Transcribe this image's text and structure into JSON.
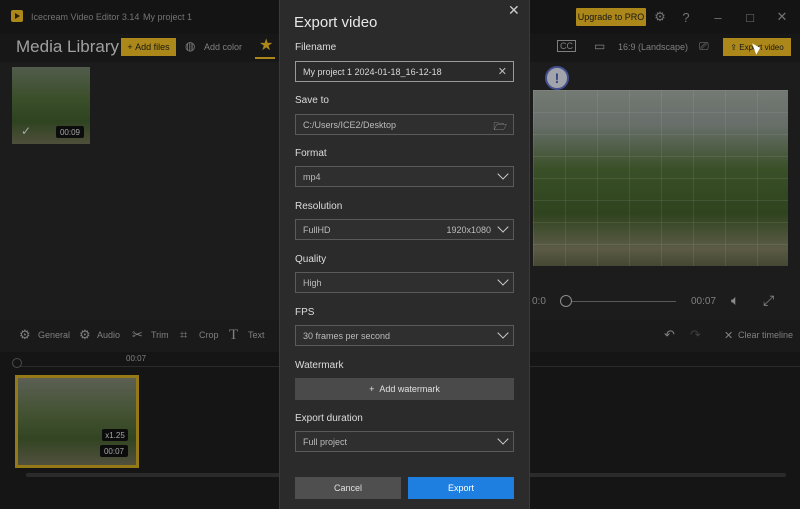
{
  "window": {
    "app_name": "Icecream Video Editor 3.14",
    "project_name": "My project 1",
    "upgrade_label": "Upgrade to PRO"
  },
  "toolbar": {
    "media_library": "Media Library",
    "add_files": "Add files",
    "add_color": "Add color",
    "aspect_ratio": "16:9 (Landscape)",
    "export_video": "Export video"
  },
  "media": {
    "clip_duration": "00:09"
  },
  "player": {
    "time_left": "0:0",
    "time_right": "00:07"
  },
  "edit_tools": {
    "general": "General",
    "audio": "Audio",
    "trim": "Trim",
    "crop": "Crop",
    "text": "Text",
    "clear_timeline": "Clear timeline"
  },
  "timeline": {
    "ruler_time": "00:07",
    "clip_speed": "x1.25",
    "clip_duration": "00:07"
  },
  "dialog": {
    "title": "Export video",
    "filename_label": "Filename",
    "filename_value": "My project 1 2024-01-18_16-12-18",
    "save_to_label": "Save to",
    "save_to_value": "C:/Users/ICE2/Desktop",
    "format_label": "Format",
    "format_value": "mp4",
    "resolution_label": "Resolution",
    "resolution_value": "FullHD",
    "resolution_size": "1920x1080",
    "quality_label": "Quality",
    "quality_value": "High",
    "fps_label": "FPS",
    "fps_value": "30 frames per second",
    "watermark_label": "Watermark",
    "add_watermark": "Add watermark",
    "export_duration_label": "Export duration",
    "export_duration_value": "Full project",
    "cancel": "Cancel",
    "export": "Export"
  },
  "colors": {
    "accent": "#e6b422",
    "primary_button": "#1f7fe0"
  }
}
